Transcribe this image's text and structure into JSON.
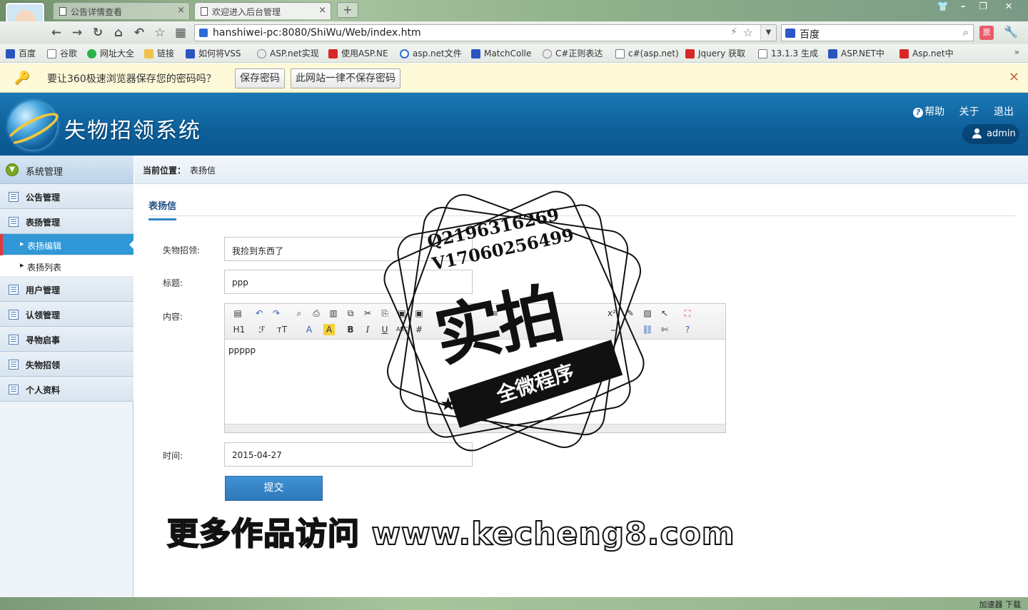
{
  "browser": {
    "tabs": [
      {
        "title": "公告详情查看",
        "active": false
      },
      {
        "title": "欢迎进入后台管理",
        "active": true
      }
    ],
    "new_tab": "+",
    "url": "hanshiwei-pc:8080/ShiWu/Web/index.htm",
    "search_engine": "百度",
    "bookmarks": [
      "百度",
      "谷歌",
      "网址大全",
      "链接",
      "如何将VSS",
      "ASP.net实现",
      "使用ASP.NE",
      "asp.net文件",
      "MatchColle",
      "C#正则表达",
      "c#(asp.net)",
      "Jquery 获取",
      "13.1.3 生成",
      "ASP.NET中",
      "Asp.net中"
    ],
    "bookmarks_more": "»",
    "password_bar": {
      "message": "要让360极速浏览器保存您的密码吗？",
      "save_button": "保存密码",
      "never_button": "此网站一律不保存密码"
    },
    "status_right": "加速器  下载"
  },
  "app": {
    "title": "失物招领系统",
    "header_links": {
      "help": "帮助",
      "about": "关于",
      "logout": "退出"
    },
    "user": "admin"
  },
  "sidebar": {
    "section": "系统管理",
    "items": [
      {
        "label": "公告管理"
      },
      {
        "label": "表扬管理"
      },
      {
        "label": "表扬编辑",
        "sub": true,
        "active": true
      },
      {
        "label": "表扬列表",
        "sub": true
      },
      {
        "label": "用户管理"
      },
      {
        "label": "认领管理"
      },
      {
        "label": "寻物启事"
      },
      {
        "label": "失物招领"
      },
      {
        "label": "个人资料"
      }
    ]
  },
  "content": {
    "breadcrumb_label": "当前位置：",
    "breadcrumb_value": "表扬信",
    "tab": "表扬信",
    "form": {
      "lost_found_label": "失物招领:",
      "lost_found_value": "我捡到东西了",
      "title_label": "标题:",
      "title_value": "ppp",
      "content_label": "内容:",
      "content_value": "ppppp",
      "time_label": "时间:",
      "time_value": "2015-04-27",
      "submit": "提交"
    },
    "editor_toolbar": [
      "H1",
      "A",
      "B",
      "I",
      "U"
    ]
  },
  "watermark": {
    "qq": "Q2196316269",
    "wx": "V17060256499",
    "big": "实拍",
    "ribbon": "全微程序",
    "promo": "更多作品访问 www.kecheng8.com"
  }
}
